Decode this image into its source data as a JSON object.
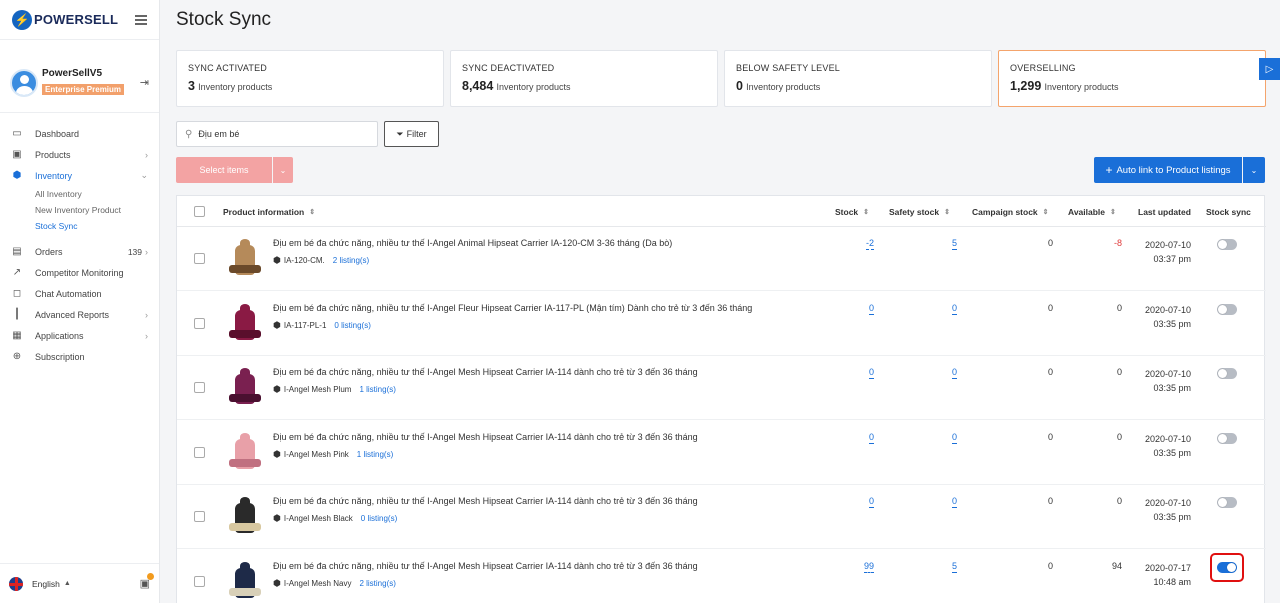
{
  "brand": {
    "name": "POWERSELL"
  },
  "user": {
    "name": "PowerSellV5",
    "plan": "Enterprise Premium"
  },
  "nav": {
    "dashboard": "Dashboard",
    "products": "Products",
    "inventory": "Inventory",
    "all_inventory": "All Inventory",
    "new_inventory_product": "New Inventory Product",
    "stock_sync": "Stock Sync",
    "orders": "Orders",
    "orders_count": "139",
    "competitor_monitoring": "Competitor Monitoring",
    "chat_automation": "Chat Automation",
    "advanced_reports": "Advanced Reports",
    "applications": "Applications",
    "subscription": "Subscription"
  },
  "footer": {
    "language": "English"
  },
  "page": {
    "title": "Stock Sync"
  },
  "stats": [
    {
      "title": "SYNC ACTIVATED",
      "value": "3",
      "unit": "Inventory products"
    },
    {
      "title": "SYNC DEACTIVATED",
      "value": "8,484",
      "unit": "Inventory products"
    },
    {
      "title": "BELOW SAFETY LEVEL",
      "value": "0",
      "unit": "Inventory products"
    },
    {
      "title": "OVERSELLING",
      "value": "1,299",
      "unit": "Inventory products"
    }
  ],
  "search": {
    "value": "Địu em bé"
  },
  "toolbar": {
    "filter": "Filter",
    "select_items": "Select items",
    "auto_link": "Auto link to Product listings"
  },
  "table": {
    "headers": {
      "product": "Product information",
      "stock": "Stock",
      "safety": "Safety stock",
      "campaign": "Campaign stock",
      "available": "Available",
      "updated": "Last updated",
      "sync": "Stock sync"
    },
    "rows": [
      {
        "name": "Địu em bé đa chức năng, nhiều tư thế I-Angel Animal Hipseat Carrier IA-120-CM 3-36 tháng (Da bò)",
        "sku": "IA-120-CM.",
        "listings": "2 listing(s)",
        "stock": "-2",
        "safety": "5",
        "campaign": "0",
        "available": "-8",
        "date": "2020-07-10",
        "time": "03:37 pm",
        "sync": false,
        "color": "#b58a5a",
        "belt": "#6b4a2a"
      },
      {
        "name": "Địu em bé đa chức năng, nhiều tư thế I-Angel Fleur Hipseat Carrier IA-117-PL (Mận tím) Dành cho trẻ từ 3 đến 36 tháng",
        "sku": "IA-117-PL-1",
        "listings": "0 listing(s)",
        "stock": "0",
        "safety": "0",
        "campaign": "0",
        "available": "0",
        "date": "2020-07-10",
        "time": "03:35 pm",
        "sync": false,
        "color": "#8a1a44",
        "belt": "#5a0f2c"
      },
      {
        "name": "Địu em bé đa chức năng, nhiều tư thế I-Angel Mesh Hipseat Carrier IA-114 dành cho trẻ từ 3 đến 36 tháng",
        "sku": "I-Angel Mesh Plum",
        "listings": "1 listing(s)",
        "stock": "0",
        "safety": "0",
        "campaign": "0",
        "available": "0",
        "date": "2020-07-10",
        "time": "03:35 pm",
        "sync": false,
        "color": "#7a2050",
        "belt": "#4a1030"
      },
      {
        "name": "Địu em bé đa chức năng, nhiều tư thế I-Angel Mesh Hipseat Carrier IA-114 dành cho trẻ từ 3 đến 36 tháng",
        "sku": "I-Angel Mesh Pink",
        "listings": "1 listing(s)",
        "stock": "0",
        "safety": "0",
        "campaign": "0",
        "available": "0",
        "date": "2020-07-10",
        "time": "03:35 pm",
        "sync": false,
        "color": "#e8a0a8",
        "belt": "#c07080"
      },
      {
        "name": "Địu em bé đa chức năng, nhiều tư thế I-Angel Mesh Hipseat Carrier IA-114 dành cho trẻ từ 3 đến 36 tháng",
        "sku": "I-Angel Mesh Black",
        "listings": "0 listing(s)",
        "stock": "0",
        "safety": "0",
        "campaign": "0",
        "available": "0",
        "date": "2020-07-10",
        "time": "03:35 pm",
        "sync": false,
        "color": "#2a2a2a",
        "belt": "#d8c8a0"
      },
      {
        "name": "Địu em bé đa chức năng, nhiều tư thế I-Angel Mesh Hipseat Carrier IA-114 dành cho trẻ từ 3 đến 36 tháng",
        "sku": "I-Angel Mesh Navy",
        "listings": "2 listing(s)",
        "stock": "99",
        "safety": "5",
        "campaign": "0",
        "available": "94",
        "date": "2020-07-17",
        "time": "10:48 am",
        "sync": true,
        "color": "#1e2a48",
        "belt": "#d8d0b8"
      }
    ]
  },
  "colors": {
    "accent": "#1a6fd8",
    "danger": "#e03b3b",
    "select_disabled": "#f3a3a3",
    "overselling_border": "#f4a46c"
  }
}
